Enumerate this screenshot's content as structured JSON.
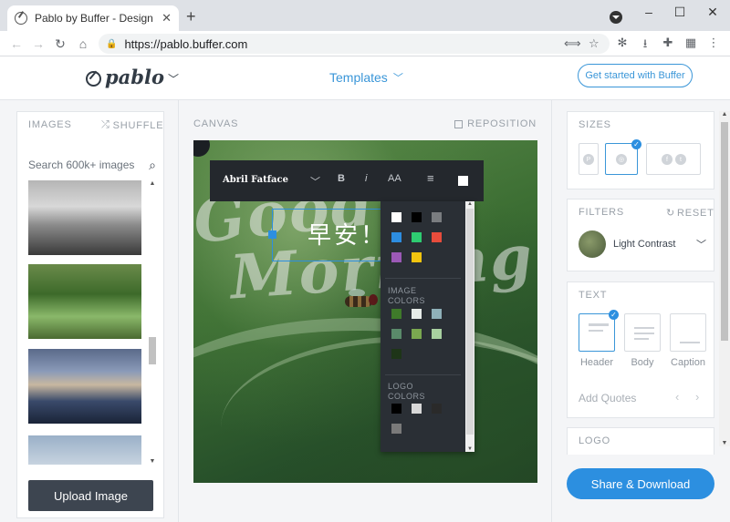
{
  "browser": {
    "tab_title": "Pablo by Buffer - Design engag",
    "tab_close": "✕",
    "new_tab": "+",
    "url": "https://pablo.buffer.com",
    "window_controls": {
      "minimize": "–",
      "maximize": "☐",
      "close": "✕"
    }
  },
  "header": {
    "logo": "pablo",
    "templates_label": "Templates",
    "cta_label": "Get started with Buffer"
  },
  "images_panel": {
    "title": "IMAGES",
    "shuffle_label": "SHUFFLE",
    "search_placeholder": "Search 600k+ images",
    "thumbnails": [
      {
        "description": "grayscale beach with person and surfboard"
      },
      {
        "description": "green plant leaves"
      },
      {
        "description": "sunset sky over water with people"
      },
      {
        "description": "mountain peak under sky"
      }
    ],
    "upload_label": "Upload Image"
  },
  "canvas": {
    "label": "CANVAS",
    "reposition_label": "REPOSITION",
    "overlay_text": "早安！",
    "background_script_top": "Good",
    "background_script_bottom": "Morning"
  },
  "text_toolbar": {
    "font_name": "Abril Fatface",
    "bold_label": "B",
    "italic_label": "i",
    "size_label": "AA",
    "align_label": "≡"
  },
  "color_picker": {
    "basic_colors": [
      "#ffffff",
      "#000000",
      "#7a7d80",
      "#2d8de0",
      "#2ecc71",
      "#e74c3c",
      "#9b59b6",
      "#f1c40f"
    ],
    "image_colors_label": "IMAGE COLORS",
    "image_colors": [
      "#3f7a2a",
      "#e6ece8",
      "#8fb0b8",
      "#5a8a6a",
      "#7aa850",
      "#a8d0a0",
      "#1e3518"
    ],
    "logo_colors_label": "LOGO COLORS",
    "logo_colors": [
      "#000000",
      "#d8d8d8",
      "#2a2a2a",
      "#7a7a7a"
    ]
  },
  "sizes_panel": {
    "title": "SIZES"
  },
  "filters_panel": {
    "title": "FILTERS",
    "reset_label": "RESET",
    "current_filter": "Light Contrast"
  },
  "text_panel": {
    "title": "TEXT",
    "styles": [
      "Header",
      "Body",
      "Caption"
    ],
    "add_quotes_label": "Add Quotes"
  },
  "logo_panel": {
    "title": "LOGO"
  },
  "share_label": "Share & Download"
}
